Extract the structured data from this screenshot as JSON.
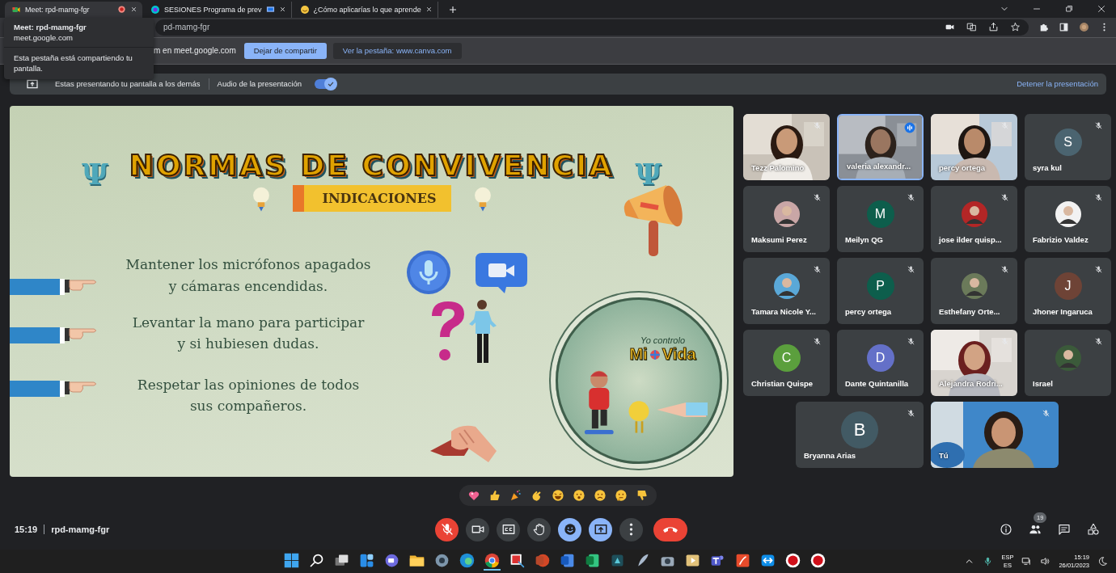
{
  "browser": {
    "tabs": [
      {
        "title": "Meet: rpd-mamg-fgr",
        "selected": true,
        "kind": "meet",
        "recording": true,
        "casting": false
      },
      {
        "title": "SESIONES Programa de prev",
        "selected": false,
        "kind": "canva",
        "recording": false,
        "casting": true
      },
      {
        "title": "¿Cómo aplicarías lo que aprende",
        "selected": false,
        "kind": "emoji",
        "recording": false,
        "casting": false
      }
    ],
    "address": "pd-mamg-fgr",
    "tooltip": {
      "title": "Meet: rpd-mamg-fgr",
      "host": "meet.google.com",
      "note": "Esta pestaña está compartiendo tu pantalla."
    },
    "share_bar": {
      "text": "m en meet.google.com",
      "buttons": [
        {
          "label": "Dejar de compartir",
          "primary": true
        },
        {
          "label": "Ver la pestaña: www.canva.com",
          "primary": false
        }
      ]
    }
  },
  "presenting_bar": {
    "message": "Estas presentando tu pantalla a los demás",
    "audio_label": "Audio de la presentación",
    "audio_on": true,
    "stop": "Detener la presentación"
  },
  "slide": {
    "symbols": [
      "Ψ",
      "Ψ"
    ],
    "title": "NORMAS DE CONVIVENCIA",
    "tag": "INDICACIONES",
    "rules": [
      "Mantener los micrófonos apagados\ny cámaras encendidas.",
      "Levantar la mano para participar\ny si hubiesen dudas.",
      "Respetar las opiniones de todos\nsus compañeros."
    ],
    "badge": {
      "caption": "Yo controlo",
      "word1": "Mi",
      "word2": "Vida"
    }
  },
  "participants": [
    {
      "name": "Tezz Palomino",
      "kind": "video",
      "muted": true
    },
    {
      "name": "valeria alexandr...",
      "kind": "video",
      "muted": false
    },
    {
      "name": "percy ortega",
      "kind": "video",
      "muted": true
    },
    {
      "name": "syra kul",
      "kind": "letter",
      "initial": "S",
      "color": "#4b6470",
      "muted": true
    },
    {
      "name": "Maksumi Perez",
      "muted": true
    },
    {
      "name": "Meilyn QG",
      "kind": "letter",
      "initial": "M",
      "color": "#0d5e4c",
      "muted": true
    },
    {
      "name": "jose ilder quisp...",
      "muted": true
    },
    {
      "name": "Fabrizio Valdez",
      "muted": true
    },
    {
      "name": "Tamara Nicole Y...",
      "muted": true
    },
    {
      "name": "percy ortega",
      "kind": "letter",
      "initial": "P",
      "color": "#0d5e4c",
      "muted": true
    },
    {
      "name": "Esthefany Orte...",
      "muted": true
    },
    {
      "name": "Jhoner Ingaruca",
      "kind": "letter",
      "initial": "J",
      "color": "#6e4336",
      "muted": true
    },
    {
      "name": "Christian Quispe",
      "kind": "letter",
      "initial": "C",
      "color": "#5b9f3d",
      "muted": true
    },
    {
      "name": "Dante Quintanilla",
      "kind": "letter",
      "initial": "D",
      "color": "#6470c8",
      "muted": true
    },
    {
      "name": "Alejandra Rodri...",
      "kind": "video",
      "muted": true
    },
    {
      "name": "Israel",
      "muted": true
    },
    {
      "name": "Bryanna Arias",
      "kind": "letter",
      "initial": "B",
      "color": "#425a64",
      "muted": true
    },
    {
      "name": "Tú",
      "kind": "video",
      "muted": true
    }
  ],
  "meeting": {
    "time": "15:19",
    "code": "rpd-mamg-fgr",
    "controls": [
      {
        "kind": "mic",
        "off": true,
        "highlighted": false
      },
      {
        "kind": "camera",
        "off": false,
        "highlighted": false
      },
      {
        "kind": "captions",
        "highlighted": false
      },
      {
        "kind": "hand",
        "highlighted": false
      },
      {
        "kind": "emoji",
        "highlighted": true
      },
      {
        "kind": "present",
        "highlighted": true
      },
      {
        "kind": "more",
        "highlighted": false
      },
      {
        "kind": "hangup",
        "highlighted": false
      }
    ],
    "people_count": "19"
  },
  "taskbar": {
    "language": "ESP",
    "layout": "ES",
    "time": "15:19",
    "date": "26/01/2023"
  }
}
